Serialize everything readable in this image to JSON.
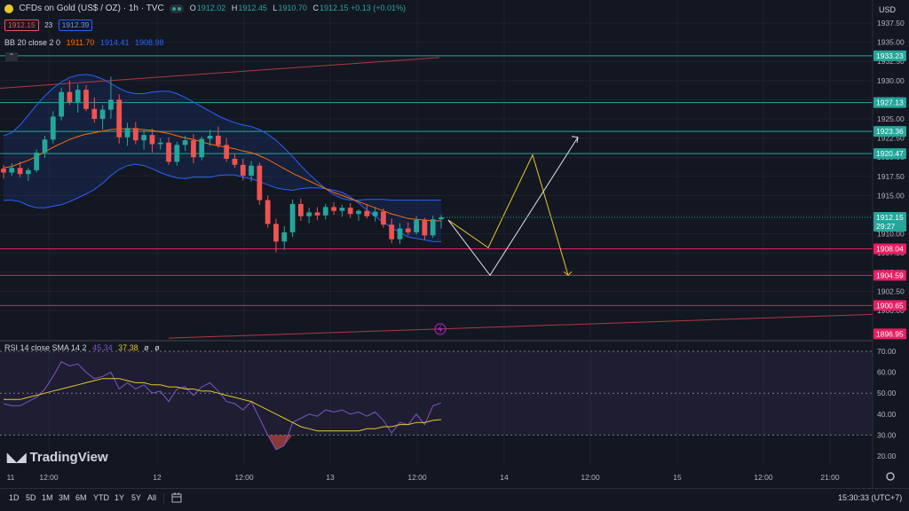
{
  "header": {
    "symbol": "CFDs on Gold (US$ / OZ) · 1h · TVC",
    "ohlc": [
      {
        "k": "O",
        "v": "1912.02"
      },
      {
        "k": "H",
        "v": "1912.45"
      },
      {
        "k": "L",
        "v": "1910.70"
      },
      {
        "k": "C",
        "v": "1912.15 +0.13 (+0.01%)"
      }
    ],
    "bid": "1912.15",
    "spread": "23",
    "ask": "1912.39",
    "currency": "USD"
  },
  "bb_legend": {
    "name": "BB 20 close 2 0",
    "basis": "1911.70",
    "upper": "1914.41",
    "lower": "1908.98"
  },
  "rsi_legend": {
    "name": "RSI 14 close SMA 14 2",
    "rsi": "45.34",
    "sma": "37.38",
    "extra1": "ø",
    "extra2": "ø"
  },
  "price_axis": {
    "min": 1894,
    "max": 1940,
    "ticks": [
      "1937.50",
      "1935.00",
      "1932.50",
      "1930.00",
      "1927.50",
      "1925.00",
      "1922.50",
      "1920.00",
      "1917.50",
      "1915.00",
      "1912.50",
      "1910.00",
      "1907.50",
      "1905.00",
      "1902.50",
      "1900.00"
    ],
    "tick_values": [
      1937.5,
      1935,
      1932.5,
      1930,
      1927.5,
      1925,
      1922.5,
      1920,
      1917.5,
      1915,
      1912.5,
      1910,
      1907.5,
      1905,
      1902.5,
      1900
    ],
    "level_labels": [
      {
        "text": "1933.23",
        "value": 1933.23,
        "color": "#26a69a"
      },
      {
        "text": "1927.13",
        "value": 1927.13,
        "color": "#26a69a"
      },
      {
        "text": "1923.36",
        "value": 1923.36,
        "color": "#26a69a"
      },
      {
        "text": "1920.47",
        "value": 1920.47,
        "color": "#26a69a"
      },
      {
        "text": "1908.04",
        "value": 1908.04,
        "color": "#e91e63"
      },
      {
        "text": "1904.59",
        "value": 1904.59,
        "color": "#e91e63"
      },
      {
        "text": "1900.65",
        "value": 1900.65,
        "color": "#e91e63"
      },
      {
        "text": "1896.95",
        "value": 1896.95,
        "color": "#e91e63"
      }
    ],
    "last_price": "1912.15",
    "countdown": "29:27"
  },
  "rsi_axis": {
    "ticks": [
      "70.00",
      "60.00",
      "50.00",
      "40.00",
      "30.00",
      "20.00"
    ],
    "tick_values": [
      70,
      60,
      50,
      40,
      30,
      20
    ]
  },
  "time_axis": {
    "labels": [
      "11",
      "12:00",
      "12",
      "12:00",
      "13",
      "12:00",
      "14",
      "12:00",
      "15",
      "12:00",
      "21:00"
    ]
  },
  "bottom_bar": {
    "ranges": [
      "1D",
      "5D",
      "1M",
      "3M",
      "6M",
      "YTD",
      "1Y",
      "5Y",
      "All"
    ],
    "clock": "15:30:33 (UTC+7)"
  },
  "branding": {
    "logo_text": "TradingView"
  },
  "colors": {
    "bull": "#26a69a",
    "bear": "#ef5350",
    "bb_line": "#2962ff",
    "basis": "#ff6d00",
    "rsi": "#7e57c2",
    "rsi_sma": "#e5c82a",
    "support": "#e91e63",
    "resistance": "#26a69a",
    "bg": "#131722"
  },
  "chart_data": {
    "type": "candlestick",
    "series_y_range": [
      1894,
      1940
    ],
    "candles": [
      [
        1918.5,
        1919.0,
        1917.2,
        1918.0
      ],
      [
        1918.0,
        1919.2,
        1917.6,
        1918.6
      ],
      [
        1918.6,
        1919.4,
        1917.4,
        1917.8
      ],
      [
        1917.8,
        1918.6,
        1916.9,
        1918.3
      ],
      [
        1918.3,
        1921.0,
        1918.0,
        1920.6
      ],
      [
        1920.6,
        1922.8,
        1919.9,
        1922.3
      ],
      [
        1922.3,
        1926.0,
        1921.8,
        1925.3
      ],
      [
        1925.3,
        1929.0,
        1924.8,
        1928.5
      ],
      [
        1928.5,
        1930.0,
        1926.8,
        1927.2
      ],
      [
        1927.2,
        1929.5,
        1925.8,
        1928.8
      ],
      [
        1928.8,
        1929.4,
        1926.0,
        1926.3
      ],
      [
        1926.3,
        1927.8,
        1924.5,
        1925.0
      ],
      [
        1925.0,
        1926.8,
        1923.6,
        1926.2
      ],
      [
        1926.2,
        1930.5,
        1925.0,
        1927.5
      ],
      [
        1927.5,
        1928.2,
        1921.8,
        1922.6
      ],
      [
        1922.6,
        1924.5,
        1921.5,
        1923.8
      ],
      [
        1923.8,
        1924.6,
        1921.7,
        1922.2
      ],
      [
        1922.2,
        1923.5,
        1921.0,
        1922.9
      ],
      [
        1922.9,
        1923.7,
        1920.6,
        1921.7
      ],
      [
        1921.7,
        1922.5,
        1921.0,
        1921.9
      ],
      [
        1921.9,
        1922.6,
        1919.0,
        1919.4
      ],
      [
        1919.4,
        1922.0,
        1918.9,
        1921.6
      ],
      [
        1921.6,
        1922.8,
        1920.8,
        1922.2
      ],
      [
        1922.2,
        1923.0,
        1919.2,
        1920.0
      ],
      [
        1920.0,
        1922.7,
        1919.6,
        1922.4
      ],
      [
        1922.4,
        1923.6,
        1921.5,
        1922.8
      ],
      [
        1922.8,
        1924.0,
        1921.2,
        1921.6
      ],
      [
        1921.6,
        1922.5,
        1919.4,
        1919.8
      ],
      [
        1919.8,
        1920.4,
        1918.6,
        1919.0
      ],
      [
        1919.0,
        1919.8,
        1917.0,
        1917.6
      ],
      [
        1917.6,
        1919.5,
        1916.8,
        1918.9
      ],
      [
        1918.9,
        1919.3,
        1913.8,
        1914.4
      ],
      [
        1914.4,
        1915.0,
        1910.8,
        1911.3
      ],
      [
        1911.3,
        1912.0,
        1907.6,
        1909.0
      ],
      [
        1909.0,
        1911.0,
        1907.9,
        1910.2
      ],
      [
        1910.2,
        1914.5,
        1909.6,
        1913.9
      ],
      [
        1913.9,
        1914.6,
        1911.7,
        1912.3
      ],
      [
        1912.3,
        1913.4,
        1911.4,
        1912.8
      ],
      [
        1912.8,
        1913.5,
        1911.8,
        1912.4
      ],
      [
        1912.4,
        1913.9,
        1911.9,
        1913.5
      ],
      [
        1913.5,
        1914.1,
        1912.5,
        1913.0
      ],
      [
        1913.0,
        1913.8,
        1912.2,
        1913.4
      ],
      [
        1913.4,
        1914.0,
        1912.1,
        1912.6
      ],
      [
        1912.6,
        1913.2,
        1911.7,
        1913.0
      ],
      [
        1913.0,
        1913.9,
        1912.0,
        1912.3
      ],
      [
        1912.3,
        1913.5,
        1911.6,
        1912.9
      ],
      [
        1912.9,
        1913.3,
        1910.8,
        1911.2
      ],
      [
        1911.2,
        1912.0,
        1908.8,
        1909.3
      ],
      [
        1909.3,
        1911.4,
        1908.7,
        1910.7
      ],
      [
        1910.7,
        1911.5,
        1909.8,
        1910.2
      ],
      [
        1910.2,
        1912.3,
        1909.9,
        1911.8
      ],
      [
        1911.8,
        1912.1,
        1909.2,
        1909.8
      ],
      [
        1909.8,
        1912.4,
        1909.5,
        1911.9
      ],
      [
        1911.9,
        1912.45,
        1910.7,
        1912.15
      ]
    ],
    "bb_upper": [
      1922.8,
      1923.2,
      1924.2,
      1925.5,
      1926.8,
      1928.0,
      1929.0,
      1929.8,
      1930.4,
      1930.7,
      1930.8,
      1930.6,
      1930.2,
      1929.6,
      1929.0,
      1928.5,
      1928.3,
      1928.3,
      1928.5,
      1928.6,
      1928.6,
      1928.3,
      1927.8,
      1927.2,
      1926.6,
      1926.0,
      1925.4,
      1924.9,
      1924.5,
      1924.2,
      1924.0,
      1923.6,
      1923.0,
      1922.2,
      1921.2,
      1920.1,
      1918.9,
      1917.8,
      1916.8,
      1915.9,
      1915.1,
      1914.6,
      1914.4,
      1914.4,
      1914.5,
      1914.5,
      1914.5,
      1914.4,
      1914.4,
      1914.4,
      1914.4,
      1914.4,
      1914.4,
      1914.41
    ],
    "bb_basis": [
      1918.6,
      1918.8,
      1919.2,
      1919.6,
      1920.1,
      1920.7,
      1921.3,
      1921.8,
      1922.3,
      1922.7,
      1923.0,
      1923.2,
      1923.4,
      1923.6,
      1923.7,
      1923.7,
      1923.7,
      1923.6,
      1923.5,
      1923.3,
      1923.1,
      1922.8,
      1922.5,
      1922.3,
      1922.0,
      1921.7,
      1921.5,
      1921.3,
      1921.1,
      1920.8,
      1920.6,
      1920.2,
      1919.7,
      1919.1,
      1918.5,
      1917.9,
      1917.4,
      1916.9,
      1916.4,
      1915.9,
      1915.4,
      1915.0,
      1914.6,
      1914.2,
      1913.8,
      1913.4,
      1913.0,
      1912.6,
      1912.3,
      1912.0,
      1911.9,
      1911.8,
      1911.7,
      1911.7
    ],
    "bb_lower": [
      1914.4,
      1914.4,
      1914.2,
      1913.7,
      1913.4,
      1913.4,
      1913.6,
      1913.8,
      1914.2,
      1914.7,
      1915.2,
      1915.8,
      1916.6,
      1917.6,
      1918.4,
      1918.9,
      1919.1,
      1918.9,
      1918.5,
      1918.0,
      1917.6,
      1917.3,
      1917.2,
      1917.4,
      1917.4,
      1917.4,
      1917.6,
      1917.7,
      1917.7,
      1917.4,
      1917.2,
      1916.8,
      1916.4,
      1916.0,
      1915.8,
      1915.7,
      1915.9,
      1916.0,
      1916.0,
      1915.9,
      1915.7,
      1915.4,
      1914.8,
      1914.0,
      1913.1,
      1912.3,
      1911.5,
      1910.8,
      1910.2,
      1909.6,
      1909.4,
      1909.2,
      1909.0,
      1908.98
    ],
    "rsi": [
      45,
      44,
      44,
      46,
      48,
      52,
      58,
      65,
      63,
      64,
      60,
      57,
      58,
      60,
      52,
      55,
      52,
      54,
      50,
      51,
      46,
      52,
      53,
      49,
      53,
      55,
      51,
      46,
      45,
      42,
      46,
      38,
      30,
      23,
      25,
      36,
      38,
      40,
      39,
      42,
      41,
      42,
      40,
      41,
      39,
      41,
      37,
      31,
      36,
      35,
      40,
      35,
      44,
      45.34
    ],
    "rsi_sma": [
      47,
      47,
      47,
      48,
      49,
      50,
      51,
      52,
      53,
      54,
      55,
      56,
      57,
      57,
      57,
      56,
      55,
      55,
      54,
      54,
      53,
      53,
      52,
      52,
      51,
      51,
      50,
      49,
      48,
      47,
      46,
      44,
      42,
      40,
      38,
      36,
      34,
      33,
      32,
      32,
      32,
      32,
      32,
      32,
      33,
      33,
      34,
      34,
      35,
      35,
      36,
      36,
      37,
      37.38
    ],
    "rsi_range": [
      0,
      100
    ],
    "projection_yellow": [
      [
        1911.8,
        1908.2
      ],
      [
        1910.2,
        1920.3
      ],
      [
        1904.6,
        1904.6
      ]
    ],
    "projection_white": [
      [
        1911.8,
        1904.6
      ],
      [
        1922.6
      ]
    ]
  }
}
